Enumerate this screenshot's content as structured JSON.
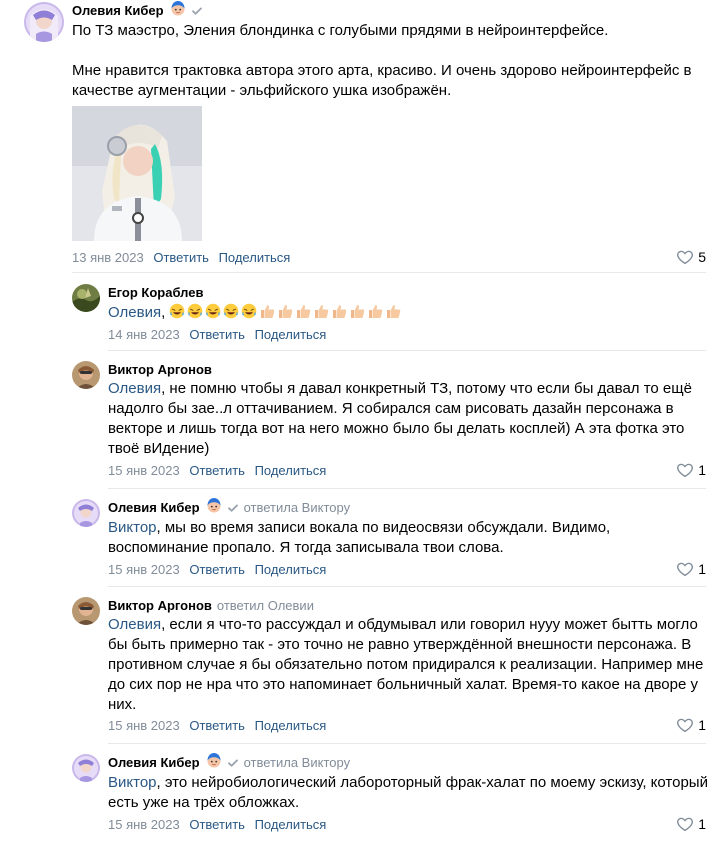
{
  "colors": {
    "link": "#2a5885",
    "meta": "#818c99",
    "divider": "#e7e8ec"
  },
  "icons": {
    "verified": "check-icon",
    "like": "heart-icon",
    "badge": "character-emoji-icon"
  },
  "comments": [
    {
      "author": "Олевия Кибер",
      "replied_to": "",
      "text_lines": [
        "По ТЗ маэстро, Эления блондинка с голубыми прядями в нейроинтерфейсе.",
        "",
        "Мне нравится трактовка автора этого арта, красиво. И очень здорово нейроинтерфейс в",
        "качестве аугментации - эльфийского ушка изображён."
      ],
      "date": "13 янв 2023",
      "reply_label": "Ответить",
      "share_label": "Поделиться",
      "likes": "5"
    },
    {
      "author": "Егор Кораблев",
      "mention": "Олевия",
      "text_after_mention": ", ",
      "emoji_sequence": [
        "rofl",
        "rofl",
        "rofl",
        "rofl",
        "rofl",
        "thumbs",
        "thumbs",
        "thumbs",
        "thumbs",
        "thumbs",
        "thumbs",
        "thumbs",
        "thumbs"
      ],
      "date": "14 янв 2023",
      "reply_label": "Ответить",
      "share_label": "Поделиться"
    },
    {
      "author": "Виктор Аргонов",
      "mention": "Олевия",
      "text_lines": [
        ", не помню чтобы я давал конкретный ТЗ, потому что если бы давал то ещё",
        "надолго бы зае..л оттачиванием. Я собирался сам рисовать дазайн персонажа в",
        "векторе и лишь тогда вот на него можно было бы делать косплей) А эта фотка это",
        "твоё вИдение)"
      ],
      "date": "15 янв 2023",
      "reply_label": "Ответить",
      "share_label": "Поделиться",
      "likes": "1"
    },
    {
      "author": "Олевия Кибер",
      "replied_to": "ответила Виктору",
      "mention": "Виктор",
      "text_lines": [
        ", мы во время записи вокала по видеосвязи обсуждали. Видимо,",
        "воспоминание пропало. Я тогда записывала твои слова."
      ],
      "date": "15 янв 2023",
      "reply_label": "Ответить",
      "share_label": "Поделиться",
      "likes": "1"
    },
    {
      "author": "Виктор Аргонов",
      "replied_to": "ответил Олевии",
      "mention": "Олевия",
      "text_lines": [
        ", если я что-то рассуждал и обдумывал или говорил нууу может бытть могло",
        "бы быть примерно так - это точно не равно утверждённой внешности персонажа. В",
        "противном случае я бы обязательно потом придирался к реализации. Например мне",
        "до сих пор не нра что это напоминает больничный халат. Время-то какое на дворе у",
        "них."
      ],
      "date": "15 янв 2023",
      "reply_label": "Ответить",
      "share_label": "Поделиться",
      "likes": "1"
    },
    {
      "author": "Олевия Кибер",
      "replied_to": "ответила Виктору",
      "mention": "Виктор",
      "text_lines": [
        ", это нейробиологический лабороторный фрак-халат по моему эскизу, который",
        "есть уже на трёх обложках."
      ],
      "date": "15 янв 2023",
      "reply_label": "Ответить",
      "share_label": "Поделиться",
      "likes": "1"
    }
  ]
}
